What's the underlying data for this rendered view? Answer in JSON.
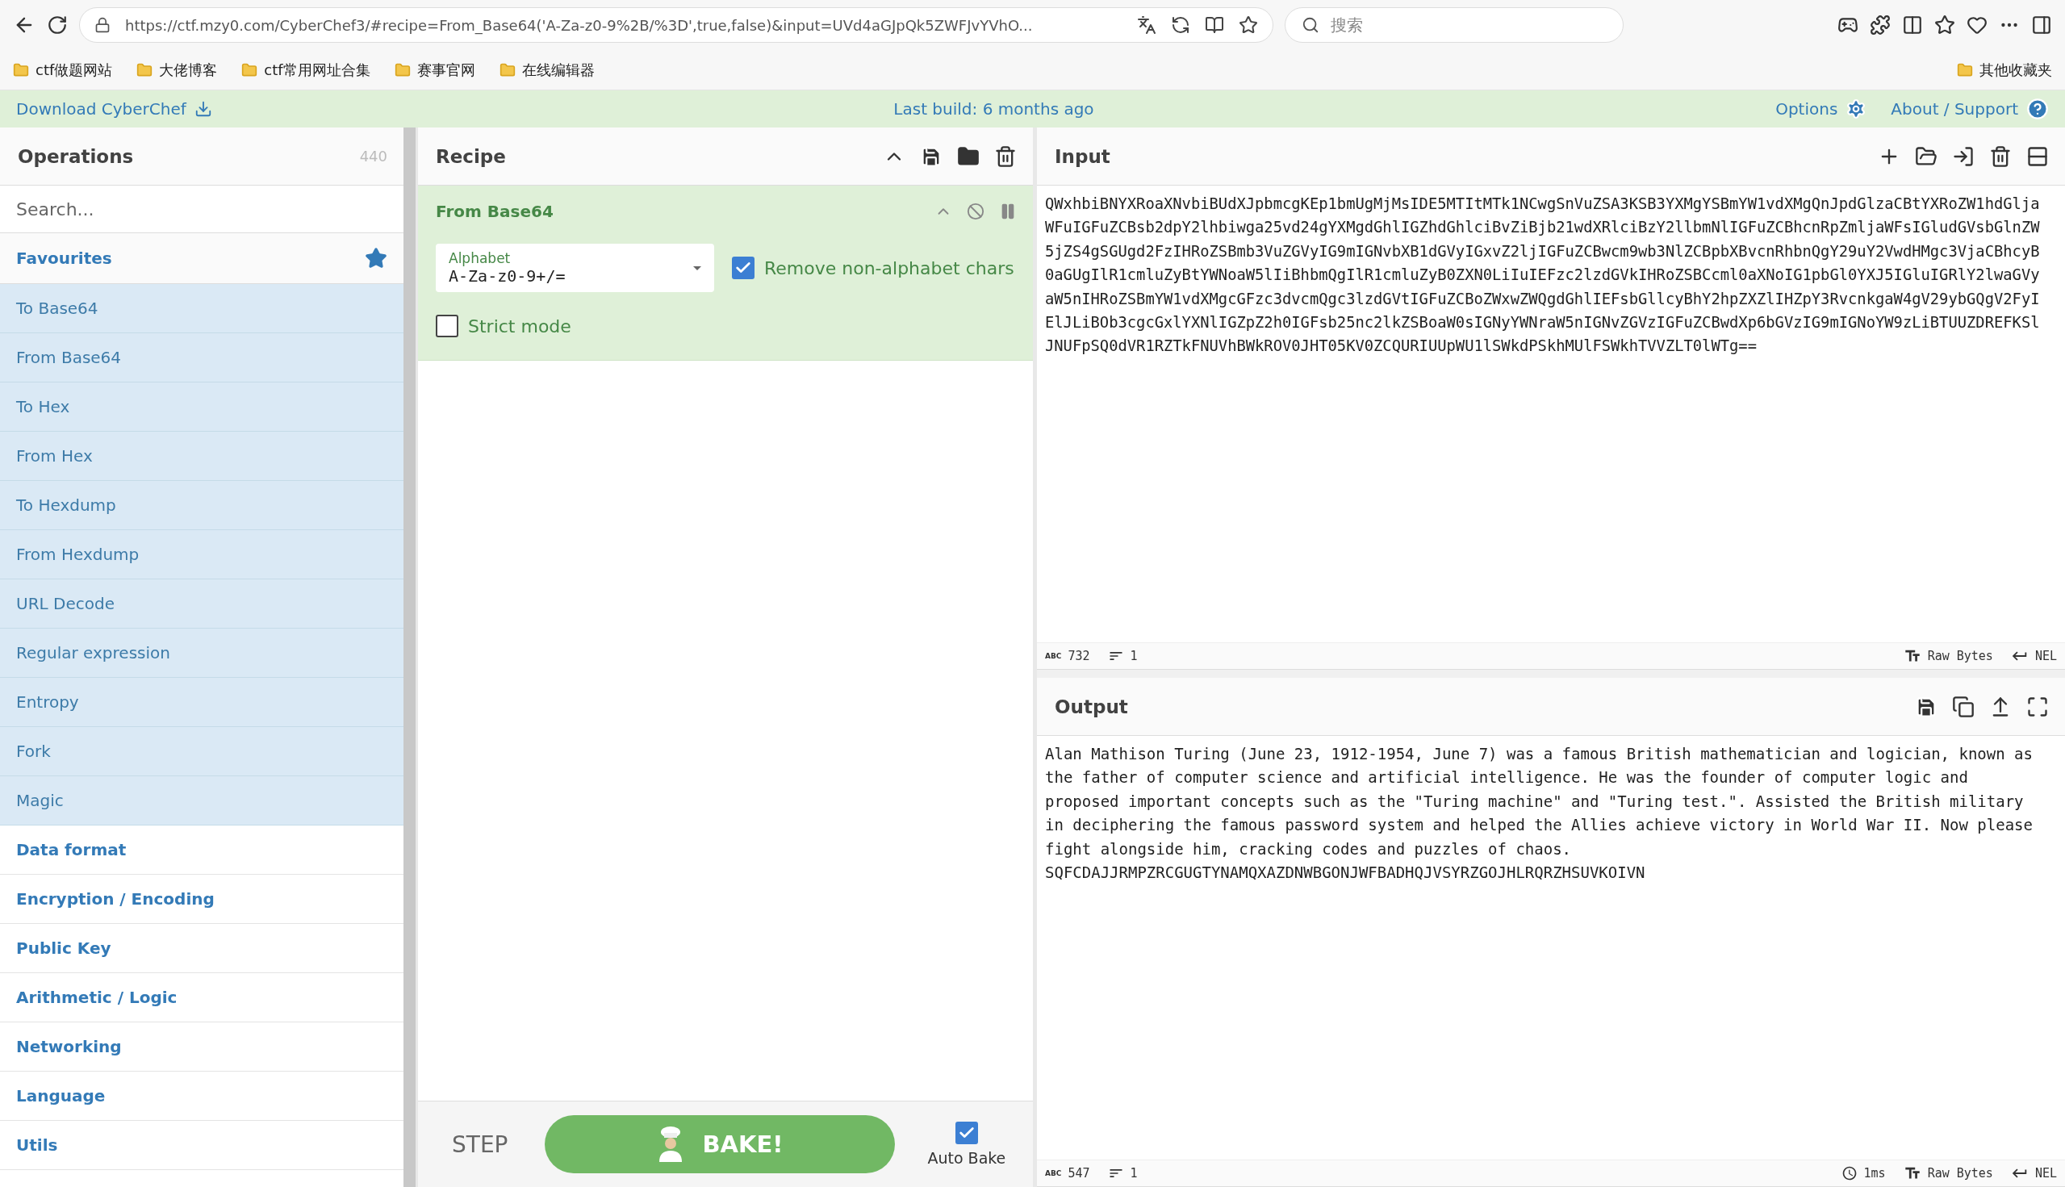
{
  "browser": {
    "url": "https://ctf.mzy0.com/CyberChef3/#recipe=From_Base64('A-Za-z0-9%2B/%3D',true,false)&input=UVd4aGJpQk5ZWFJvYVhO...",
    "search_placeholder": "搜索",
    "bookmarks": [
      "ctf做题网站",
      "大佬博客",
      "ctf常用网址合集",
      "赛事官网",
      "在线编辑器"
    ],
    "other_bookmarks": "其他收藏夹"
  },
  "banner": {
    "download": "Download CyberChef",
    "last_build": "Last build: 6 months ago",
    "options": "Options",
    "about": "About / Support"
  },
  "operations": {
    "title": "Operations",
    "count": "440",
    "search_placeholder": "Search...",
    "favourites": "Favourites",
    "favourite_items": [
      "To Base64",
      "From Base64",
      "To Hex",
      "From Hex",
      "To Hexdump",
      "From Hexdump",
      "URL Decode",
      "Regular expression",
      "Entropy",
      "Fork",
      "Magic"
    ],
    "categories": [
      "Data format",
      "Encryption / Encoding",
      "Public Key",
      "Arithmetic / Logic",
      "Networking",
      "Language",
      "Utils"
    ]
  },
  "recipe": {
    "title": "Recipe",
    "operation": {
      "name": "From Base64",
      "alphabet_label": "Alphabet",
      "alphabet_value": "A-Za-z0-9+/=",
      "remove_non_alphabet": {
        "label": "Remove non-alphabet chars",
        "checked": true
      },
      "strict_mode": {
        "label": "Strict mode",
        "checked": false
      }
    },
    "step": "STEP",
    "bake": "BAKE!",
    "auto_bake": {
      "label": "Auto Bake",
      "checked": true
    }
  },
  "input": {
    "title": "Input",
    "lines": [
      "QWxhbiBNYXRoaXNvbiBUdXJpbmcgKEp1bmUgMjMsIDE5MTItMTk1NCwgSnVuZSA3KSB3YXMgYSBmYW1vdXMgQnJpdGlzaCBtYXRoZW1hdGlja",
      "WFuIGFuZCBsb2dpY2lhbiwga25vd24gYXMgdGhlIGZhdGhlciBvZiBjb21wdXRlciBzY2llbmNlIGFuZCBhcnRpZmljaWFsIGludGVsbGlnZW",
      "5jZS4gSGUgd2FzIHRoZSBmb3VuZGVyIG9mIGNvbXB1dGVyIGxvZ2ljIGFuZCBwcm9wb3NlZCBpbXBvcnRhbnQgY29uY2VwdHMgc3VjaCBhcyB",
      "0aGUgIlR1cmluZyBtYWNoaW5lIiBhbmQgIlR1cmluZyB0ZXN0LiIuIEFzc2lzdGVkIHRoZSBCcml0aXNoIG1pbGl0YXJ5IGluIGRlY2lwaGVy",
      "aW5nIHRoZSBmYW1vdXMgcGFzc3dvcmQgc3lzdGVtIGFuZCBoZWxwZWQgdGhlIEFsbGllcyBhY2hpZXZlIHZpY3RvcnkgaW4gV29ybGQgV2FyI",
      "ElJLiBOb3cgcGxlYXNlIGZpZ2h0IGFsb25nc2lkZSBoaW0sIGNyYWNraW5nIGNvZGVzIGFuZCBwdXp6bGVzIG9mIGNoYW9zLiBTUUZDREFKSl",
      "JNUFpSQ0dVR1RZTkFNUVhBWkROV0JHT05KV0ZCQURIUUpWU1lSWkdPSkhMUlFSWkhTVVZLT0lWTg=="
    ],
    "status": {
      "length_icon": "ABC",
      "length": "732",
      "lines": "1",
      "encoding": "Raw Bytes",
      "eol": "NEL"
    }
  },
  "output": {
    "title": "Output",
    "lines": [
      "Alan Mathison Turing (June 23, 1912-1954, June 7) was a famous British mathematician and logician, known as",
      "the father of computer science and artificial intelligence. He was the founder of computer logic and",
      "proposed important concepts such as the \"Turing machine\" and \"Turing test.\". Assisted the British military",
      "in deciphering the famous password system and helped the Allies achieve victory in World War II. Now please",
      "fight alongside him, cracking codes and puzzles of chaos.",
      "SQFCDAJJRMPZRCGUGTYNAMQXAZDNWBGONJWFBADHQJVSYRZGOJHLRQRZHSUVKOIVN"
    ],
    "status": {
      "length_icon": "ABC",
      "length": "547",
      "lines": "1",
      "time": "1ms",
      "encoding": "Raw Bytes",
      "eol": "NEL"
    }
  }
}
